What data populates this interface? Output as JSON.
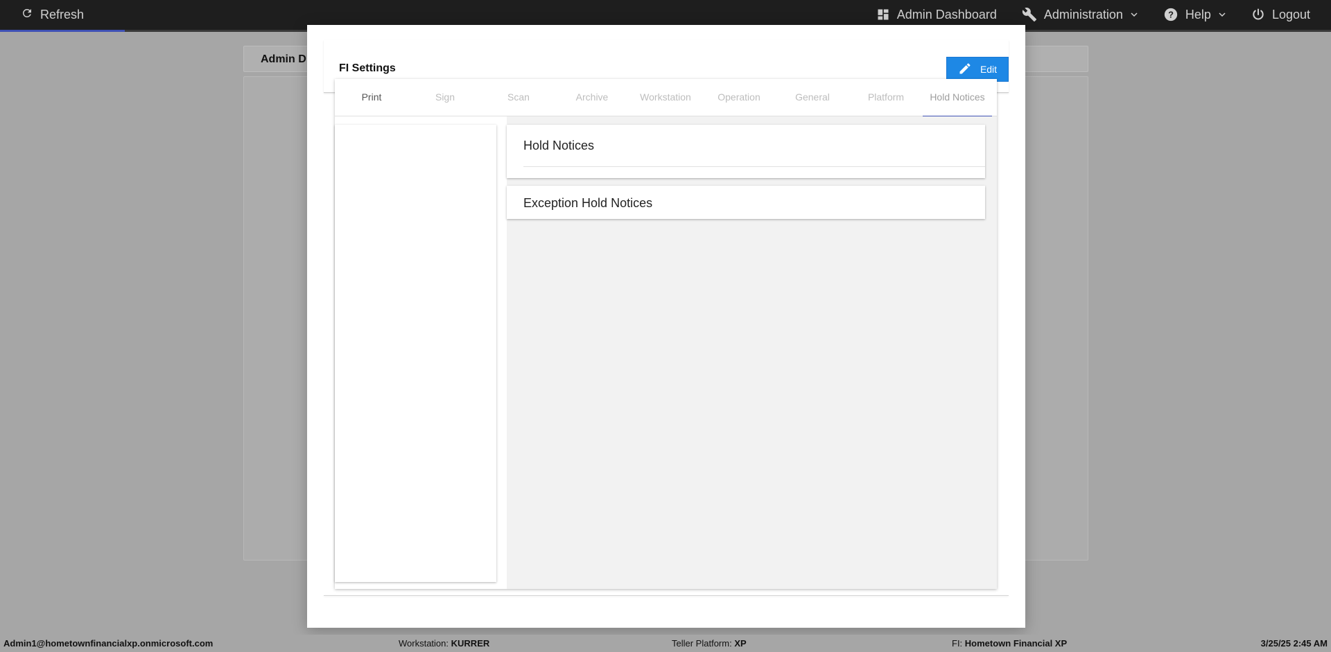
{
  "topbar": {
    "refresh_label": "Refresh",
    "progress_fraction": 0.094,
    "nav": [
      {
        "label": "Admin Dashboard"
      },
      {
        "label": "Administration"
      },
      {
        "label": "Help"
      },
      {
        "label": "Logout"
      }
    ]
  },
  "background": {
    "header_title": "Admin D"
  },
  "modal": {
    "title": "FI Settings",
    "edit_label": "Edit",
    "tabs": [
      "Print",
      "Sign",
      "Scan",
      "Archive",
      "Workstation",
      "Operation",
      "General",
      "Platform",
      "Hold Notices"
    ],
    "active_tab": "Hold Notices",
    "sections": {
      "hold_notices": "Hold Notices",
      "exception_hold_notices": "Exception Hold Notices"
    }
  },
  "statusbar": {
    "user": "Admin1@hometownfinancialxp.onmicrosoft.com",
    "workstation_label": "Workstation:",
    "workstation_value": "KURRER",
    "platform_label": "Teller Platform:",
    "platform_value": "XP",
    "fi_label": "FI:",
    "fi_value": "Hometown Financial XP",
    "datetime": "3/25/25 2:45 AM"
  },
  "colors": {
    "topbar": "#1e1e1e",
    "accent": "#3f51b5",
    "edit_button": "#1e88e5",
    "overlay": "#a6a6a6"
  }
}
